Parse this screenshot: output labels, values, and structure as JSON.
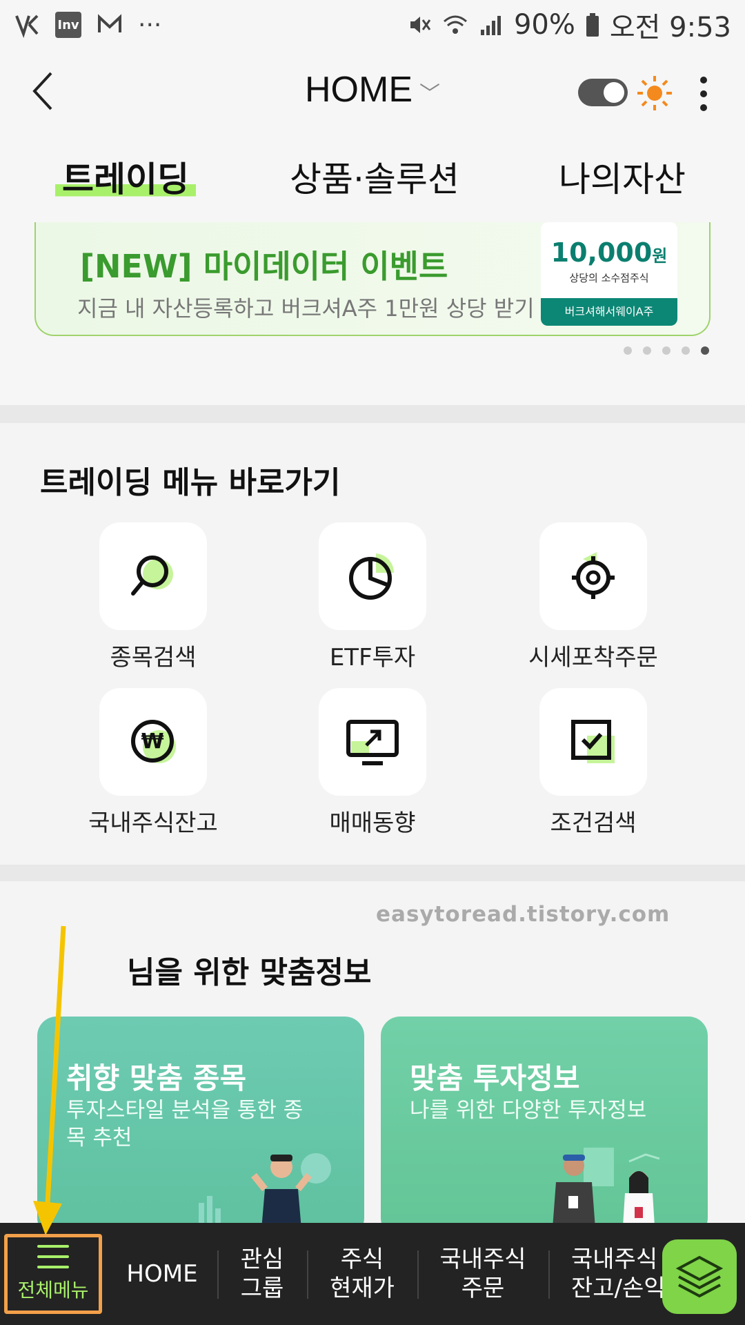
{
  "status": {
    "battery": "90%",
    "time": "오전 9:53",
    "app_icon_label": "Inv"
  },
  "header": {
    "title": "HOME",
    "theme_toggle": "dark-mode-toggle"
  },
  "tabs": [
    {
      "label": "트레이딩",
      "active": true
    },
    {
      "label": "상품·솔루션",
      "active": false
    },
    {
      "label": "나의자산",
      "active": false
    }
  ],
  "banner": {
    "title": "[NEW] 마이데이터 이벤트",
    "subtitle": "지금 내 자산등록하고 버크셔A주 1만원 상당 받기",
    "amount": "10,000",
    "amount_unit": "원",
    "card_sub": "상당의 소수점주식",
    "card_foot": "버크셔해서웨이A주",
    "page_count": 5,
    "current_page": 5
  },
  "trading_menu": {
    "title": "트레이딩 메뉴 바로가기",
    "items": [
      {
        "label": "종목검색",
        "icon": "search-icon"
      },
      {
        "label": "ETF투자",
        "icon": "pie-chart-icon"
      },
      {
        "label": "시세포착주문",
        "icon": "target-icon"
      },
      {
        "label": "국내주식잔고",
        "icon": "won-coin-icon"
      },
      {
        "label": "매매동향",
        "icon": "monitor-trend-icon"
      },
      {
        "label": "조건검색",
        "icon": "checkbox-icon"
      }
    ]
  },
  "watermark": "easytoread.tistory.com",
  "recommend": {
    "title": "님을 위한 맞춤정보",
    "cards": [
      {
        "title": "취향 맞춤 종목",
        "subtitle": "투자스타일 분석을 통한 종목 추천"
      },
      {
        "title": "맞춤 투자정보",
        "subtitle": "나를 위한 다양한 투자정보"
      }
    ]
  },
  "bottom_nav": {
    "menu_label": "전체메뉴",
    "items": [
      {
        "line1": "HOME",
        "line2": ""
      },
      {
        "line1": "관심",
        "line2": "그룹"
      },
      {
        "line1": "주식",
        "line2": "현재가"
      },
      {
        "line1": "국내주식",
        "line2": "주문"
      },
      {
        "line1": "국내주식",
        "line2": "잔고/손익"
      }
    ]
  },
  "colors": {
    "accent": "#a8f06a",
    "teal": "#0c8775",
    "highlight_box": "#f2a04a",
    "arrow": "#f5c400"
  }
}
